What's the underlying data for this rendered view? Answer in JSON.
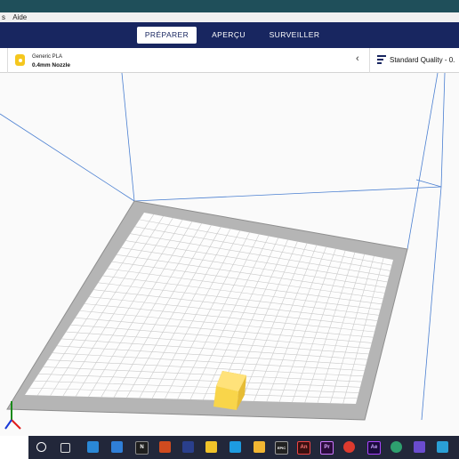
{
  "menu": {
    "items": [
      "s",
      "Aide"
    ]
  },
  "tabs": [
    {
      "label": "PRÉPARER",
      "active": true
    },
    {
      "label": "APERÇU",
      "active": false
    },
    {
      "label": "SURVEILLER",
      "active": false
    }
  ],
  "stage": {
    "material": "Generic PLA",
    "nozzle": "0.4mm Nozzle",
    "chevron": "‹",
    "quality": "Standard Quality - 0."
  },
  "colors": {
    "topbar": "#182660",
    "model": "#f8d34c",
    "extruder": "#f5c71e",
    "taskbar": "#22273a"
  },
  "taskbar": {
    "icons": [
      "start-circle-icon",
      "task-view-icon",
      "mail-icon",
      "store-icon",
      "notion-icon",
      "office-icon",
      "app-icon",
      "app-icon-2",
      "cura-icon",
      "file-explorer-icon",
      "epic-games-icon",
      "animate-icon",
      "premiere-icon",
      "chrome-icon",
      "after-effects-icon",
      "edge-icon",
      "app-icon-3",
      "app-icon-4"
    ],
    "labels": {
      "notion": "N",
      "epic": "EPIC",
      "animate": "An",
      "premiere": "Pr",
      "after_effects": "Ae"
    }
  }
}
